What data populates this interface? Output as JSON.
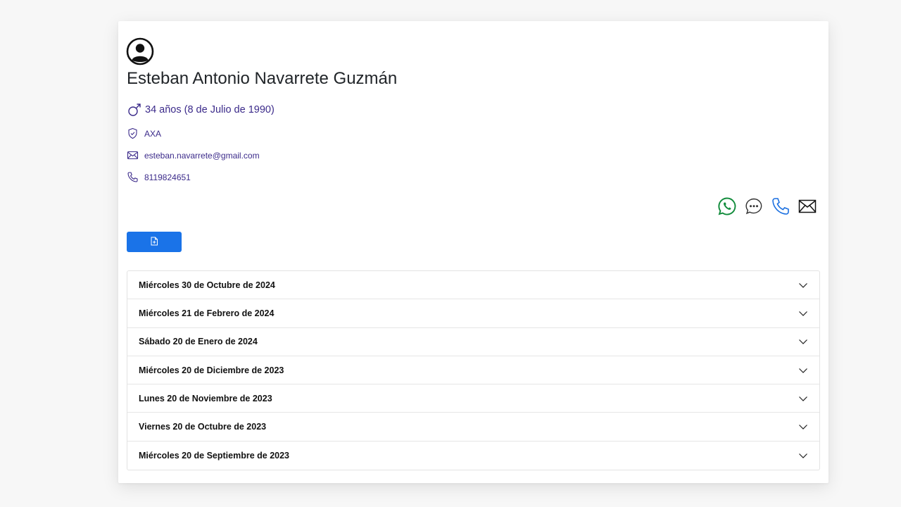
{
  "patient": {
    "name": "Esteban Antonio Navarrete Guzmán",
    "age_text": "34 años (8 de Julio de 1990)",
    "insurer": "AXA",
    "email": "esteban.navarrete@gmail.com",
    "phone": "8119824651"
  },
  "icons": {
    "avatar": "user-circle-icon",
    "gender": "male-icon",
    "insurer": "shield-check-icon",
    "email": "envelope-icon",
    "phone": "phone-icon",
    "whatsapp": "whatsapp-icon",
    "message": "chat-dots-icon",
    "call": "phone-icon",
    "mail": "envelope-icon",
    "new_document": "file-plus-icon",
    "expand": "chevron-down-icon"
  },
  "colors": {
    "whatsapp": "#128c3c",
    "call": "#1a6fe0",
    "primary_button": "#1a73e8",
    "info_text": "#3b2a8a"
  },
  "visits": [
    {
      "label": "Miércoles 30 de Octubre de 2024"
    },
    {
      "label": "Miércoles 21 de Febrero de 2024"
    },
    {
      "label": "Sábado 20 de Enero de 2024"
    },
    {
      "label": "Miércoles 20 de Diciembre de 2023"
    },
    {
      "label": "Lunes 20 de Noviembre de 2023"
    },
    {
      "label": "Viernes 20 de Octubre de 2023"
    },
    {
      "label": "Miércoles 20 de Septiembre de 2023"
    }
  ]
}
